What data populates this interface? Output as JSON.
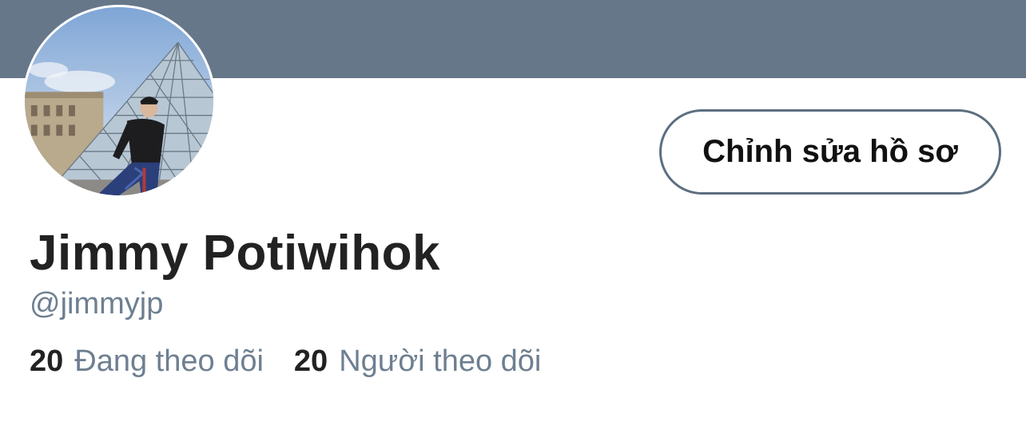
{
  "profile": {
    "name": "Jimmy Potiwihok",
    "handle": "@jimmyjp",
    "edit_button_label": "Chỉnh sửa hồ sơ",
    "following_count": "20",
    "following_label": "Đang theo dõi",
    "followers_count": "20",
    "followers_label": "Người theo dõi"
  },
  "colors": {
    "banner": "#66778a",
    "secondary_text": "#6e7f91",
    "primary_text": "#222222"
  }
}
